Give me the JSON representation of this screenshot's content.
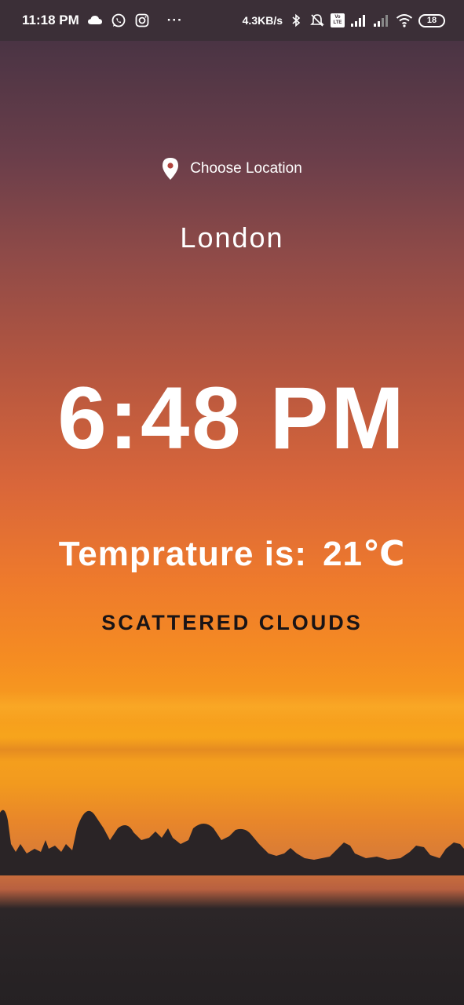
{
  "status_bar": {
    "time": "11:18 PM",
    "more": "···",
    "net_speed": "4.3KB/s",
    "volte": "Vo LTE",
    "battery_level": "18",
    "icons": [
      "cloud-icon",
      "whatsapp-icon",
      "instagram-icon",
      "bluetooth-icon",
      "bell-muted-icon",
      "volte-icon",
      "signal-icon",
      "signal-icon",
      "wifi-icon",
      "battery-icon"
    ]
  },
  "location": {
    "button_label": "Choose Location",
    "icon": "location-pin-icon",
    "city": "London"
  },
  "time_display": "6:48 PM",
  "temperature": {
    "label": "Temprature is:",
    "value": "21℃"
  },
  "description": "SCATTERED CLOUDS",
  "colors": {
    "text": "#ffffff",
    "description_text": "#1a1416",
    "status_bar_bg": "#3b2f37"
  }
}
